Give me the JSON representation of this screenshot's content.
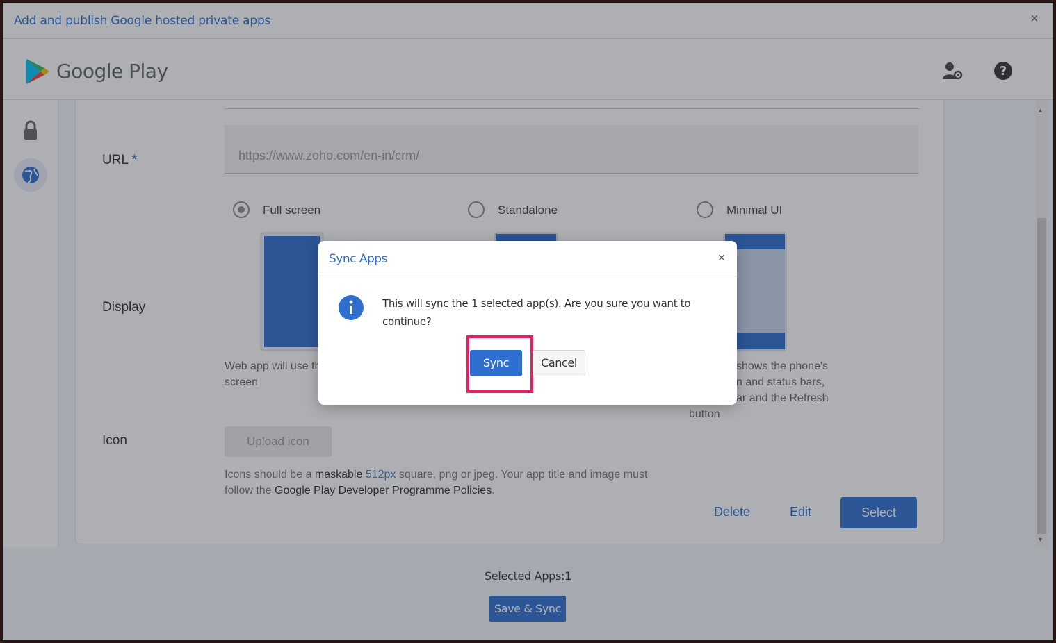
{
  "window": {
    "title": "Add and publish Google hosted private apps",
    "close_glyph": "×"
  },
  "header": {
    "brand": "Google Play",
    "icons": [
      "play-logo-icon",
      "user-settings-icon",
      "help-icon"
    ]
  },
  "rail": {
    "icons": [
      "lock-icon",
      "globe-icon"
    ]
  },
  "form": {
    "url_label": "URL",
    "required_mark": "*",
    "url_placeholder": "https://www.zoho.com/en-in/crm/",
    "display_label": "Display",
    "display_options": [
      {
        "label": "Full screen",
        "selected": true
      },
      {
        "label": "Standalone",
        "selected": false
      },
      {
        "label": "Minimal UI",
        "selected": false
      }
    ],
    "fullscreen_desc_line1": "Web app will use th",
    "fullscreen_desc_line2": "screen",
    "minimal_desc_line1": "shows the phone's",
    "minimal_desc_line2": "n and status bars,",
    "minimal_desc_line3": "ar and the Refresh",
    "minimal_desc_line4": "button",
    "icon_label": "Icon",
    "upload_label": "Upload icon",
    "icon_note_1": "Icons should be a ",
    "icon_note_maskable": "maskable",
    "icon_note_2": " ",
    "icon_note_size": "512px",
    "icon_note_3": " square, png or jpeg. Your app title and image must",
    "icon_note_4": "follow the ",
    "icon_note_policy": "Google Play Developer Programme Policies",
    "icon_note_5": ".",
    "delete_label": "Delete",
    "edit_label": "Edit",
    "select_label": "Select"
  },
  "footer": {
    "selected_apps": "Selected Apps:1",
    "save_sync_label": "Save & Sync"
  },
  "modal": {
    "title": "Sync Apps",
    "close_glyph": "×",
    "message": "This will sync the 1 selected app(s). Are you sure you want to continue?",
    "sync_label": "Sync",
    "cancel_label": "Cancel"
  },
  "colors": {
    "accent": "#2f6fcf",
    "highlight": "#e91e63"
  }
}
